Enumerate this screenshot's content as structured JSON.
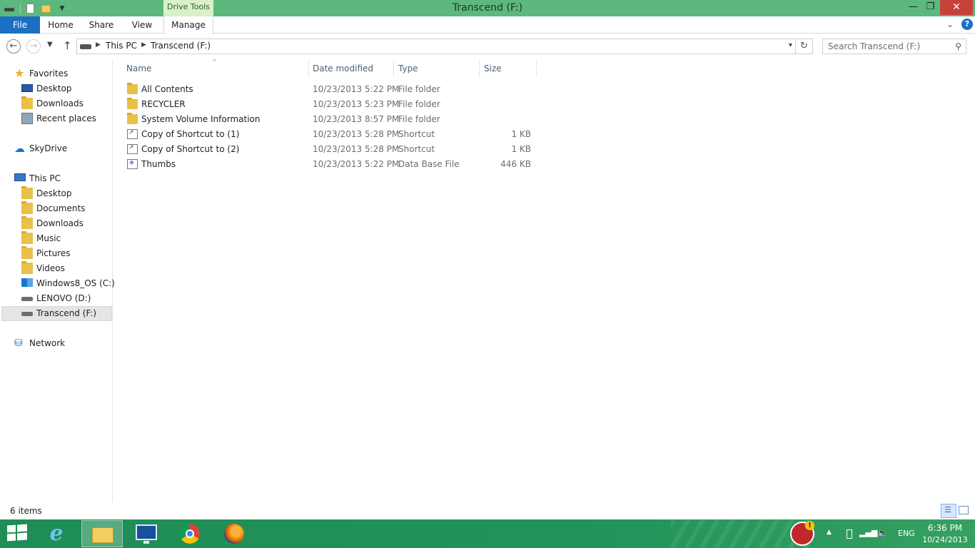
{
  "window": {
    "title": "Transcend (F:)",
    "context_tab": "Drive Tools",
    "minimize_glyph": "—",
    "restore_glyph": "❐",
    "close_glyph": "✕"
  },
  "ribbon": {
    "tabs": [
      {
        "label": "File"
      },
      {
        "label": "Home"
      },
      {
        "label": "Share"
      },
      {
        "label": "View"
      },
      {
        "label": "Manage"
      }
    ],
    "expand_glyph": "⌄",
    "help_glyph": "?"
  },
  "address": {
    "crumbs": [
      "This PC",
      "Transcend (F:)"
    ],
    "back_glyph": "←",
    "forward_glyph": "→",
    "recent_glyph": "▼",
    "up_glyph": "↑",
    "refresh_glyph": "↻",
    "dropdown_glyph": "▾",
    "search_placeholder": "Search Transcend (F:)"
  },
  "navigation": {
    "favorites": {
      "label": "Favorites",
      "items": [
        "Desktop",
        "Downloads",
        "Recent places"
      ]
    },
    "skydrive": {
      "label": "SkyDrive"
    },
    "this_pc": {
      "label": "This PC",
      "items": [
        "Desktop",
        "Documents",
        "Downloads",
        "Music",
        "Pictures",
        "Videos",
        "Windows8_OS (C:)",
        "LENOVO (D:)",
        "Transcend (F:)"
      ]
    },
    "network": {
      "label": "Network"
    },
    "selected": "Transcend (F:)"
  },
  "columns": {
    "name": "Name",
    "date_modified": "Date modified",
    "type": "Type",
    "size": "Size",
    "sort_glyph": "^"
  },
  "files": [
    {
      "name": "All Contents",
      "date": "10/23/2013 5:22 PM",
      "type": "File folder",
      "size": "",
      "icon": "folder-icon"
    },
    {
      "name": "RECYCLER",
      "date": "10/23/2013 5:23 PM",
      "type": "File folder",
      "size": "",
      "icon": "folder-icon"
    },
    {
      "name": "System Volume Information",
      "date": "10/23/2013 8:57 PM",
      "type": "File folder",
      "size": "",
      "icon": "folder-icon"
    },
    {
      "name": "Copy of Shortcut to (1)",
      "date": "10/23/2013 5:28 PM",
      "type": "Shortcut",
      "size": "1 KB",
      "icon": "shortcut-icon"
    },
    {
      "name": "Copy of Shortcut to (2)",
      "date": "10/23/2013 5:28 PM",
      "type": "Shortcut",
      "size": "1 KB",
      "icon": "shortcut-icon"
    },
    {
      "name": "Thumbs",
      "date": "10/23/2013 5:22 PM",
      "type": "Data Base File",
      "size": "446 KB",
      "icon": "database-file-icon"
    }
  ],
  "status": {
    "item_count": "6 items"
  },
  "taskbar": {
    "apps": [
      "Internet Explorer",
      "File Explorer",
      "Lenovo",
      "Google Chrome",
      "Mozilla Firefox"
    ],
    "ie_glyph": "e",
    "language": "ENG",
    "time": "6:36 PM",
    "date": "10/24/2013",
    "tray_expand_glyph": "▲",
    "signal_glyph": "▂▄▆",
    "volume_glyph": "🔈"
  },
  "colors": {
    "titlebar": "#5cb87c",
    "file_tab": "#1c6fc2",
    "context_tab": "#d9f0c8",
    "close_button": "#c7403a",
    "taskbar": "#1f8d55",
    "selection": "#e5e5e5"
  }
}
